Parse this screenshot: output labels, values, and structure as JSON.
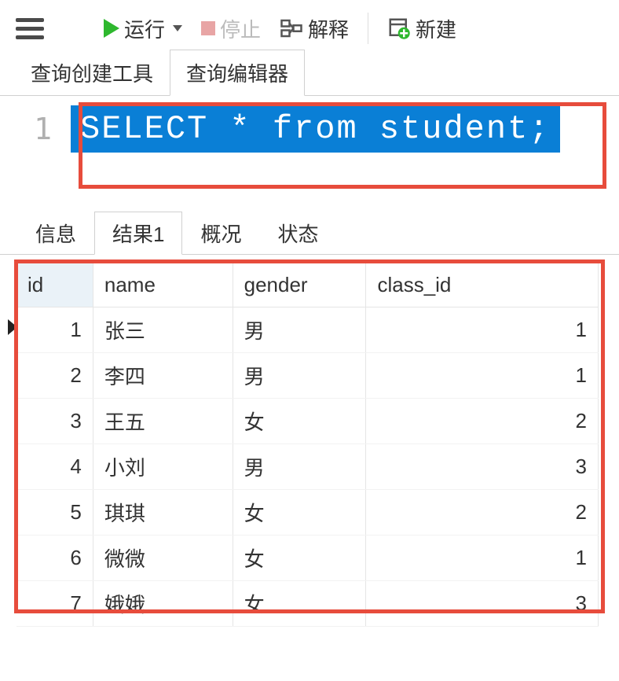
{
  "toolbar": {
    "run_label": "运行",
    "stop_label": "停止",
    "explain_label": "解释",
    "new_label": "新建"
  },
  "editor_tabs": {
    "builder_label": "查询创建工具",
    "editor_label": "查询编辑器"
  },
  "editor": {
    "line_number": "1",
    "sql_text": "SELECT * from student;"
  },
  "result_tabs": {
    "info_label": "信息",
    "result1_label": "结果1",
    "profile_label": "概况",
    "status_label": "状态"
  },
  "table": {
    "columns": {
      "id": "id",
      "name": "name",
      "gender": "gender",
      "class_id": "class_id"
    },
    "rows": [
      {
        "id": "1",
        "name": "张三",
        "gender": "男",
        "class_id": "1"
      },
      {
        "id": "2",
        "name": "李四",
        "gender": "男",
        "class_id": "1"
      },
      {
        "id": "3",
        "name": "王五",
        "gender": "女",
        "class_id": "2"
      },
      {
        "id": "4",
        "name": "小刘",
        "gender": "男",
        "class_id": "3"
      },
      {
        "id": "5",
        "name": "琪琪",
        "gender": "女",
        "class_id": "2"
      },
      {
        "id": "6",
        "name": "微微",
        "gender": "女",
        "class_id": "1"
      },
      {
        "id": "7",
        "name": "娥娥",
        "gender": "女",
        "class_id": "3"
      }
    ]
  }
}
